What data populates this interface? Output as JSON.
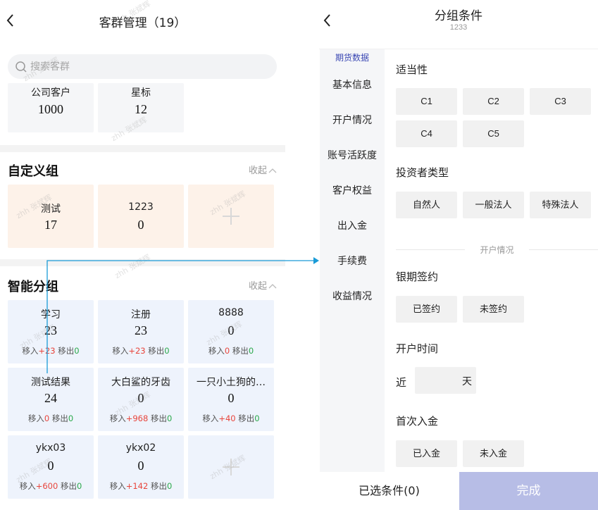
{
  "left": {
    "title": "客群管理（19）",
    "search_placeholder": "搜索客群",
    "top_cards": [
      {
        "name": "公司客户",
        "count": "1000"
      },
      {
        "name": "星标",
        "count": "12"
      }
    ],
    "custom": {
      "title": "自定义组",
      "collapse_label": "收起",
      "cards": [
        {
          "name": "测试",
          "count": "17"
        },
        {
          "name": "1223",
          "count": "0"
        }
      ]
    },
    "smart": {
      "title": "智能分组",
      "collapse_label": "收起",
      "move_in_label": "移入",
      "move_out_label": "移出",
      "cards": [
        {
          "name": "学习",
          "count": "23",
          "in": "+23",
          "out": "0"
        },
        {
          "name": "注册",
          "count": "23",
          "in": "+23",
          "out": "0"
        },
        {
          "name": "8888",
          "count": "0",
          "in": "0",
          "out": "0"
        },
        {
          "name": "测试结果",
          "count": "24",
          "in": "0",
          "out": "0"
        },
        {
          "name": "大白鲨的牙齿",
          "count": "0",
          "in": "+968",
          "out": "0"
        },
        {
          "name": "一只小土狗的…",
          "count": "0",
          "in": "+40",
          "out": "0"
        },
        {
          "name": "ykx03",
          "count": "0",
          "in": "+600",
          "out": "0"
        },
        {
          "name": "ykx02",
          "count": "0",
          "in": "+142",
          "out": "0"
        }
      ]
    },
    "watermark": "zhh 张斌辉"
  },
  "right": {
    "title": "分组条件",
    "subtitle": "1233",
    "sidebar": [
      {
        "label": "期货数据"
      },
      {
        "label": "基本信息"
      },
      {
        "label": "开户情况"
      },
      {
        "label": "账号活跃度"
      },
      {
        "label": "客户权益"
      },
      {
        "label": "出入金"
      },
      {
        "label": "手续费"
      },
      {
        "label": "收益情况"
      }
    ],
    "suitability": {
      "label": "适当性",
      "options": [
        "C1",
        "C2",
        "C3",
        "C4",
        "C5"
      ]
    },
    "investor_type": {
      "label": "投资者类型",
      "options": [
        "自然人",
        "一般法人",
        "特殊法人"
      ]
    },
    "divider_label": "开户情况",
    "bank_sign": {
      "label": "银期签约",
      "options": [
        "已签约",
        "未签约"
      ]
    },
    "open_time": {
      "label": "开户时间",
      "prefix": "近",
      "unit": "天"
    },
    "first_deposit": {
      "label": "首次入金",
      "options": [
        "已入金",
        "未入金"
      ]
    },
    "footer": {
      "selected_label": "已选条件(0)",
      "done_label": "完成"
    }
  },
  "colors": {
    "accent": "#3a47b3",
    "done_bg": "#b7bde6",
    "arrow": "#1a9bd7",
    "in_red": "#e8453c",
    "out_green": "#2aa84a"
  }
}
